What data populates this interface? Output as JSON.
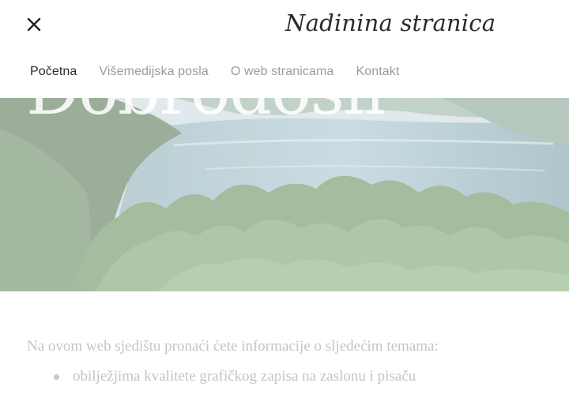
{
  "header": {
    "site_title": "Nadinina stranica",
    "close_icon": "close-icon"
  },
  "nav": {
    "items": [
      {
        "label": "Početna",
        "active": true
      },
      {
        "label": "Višemedijska posla",
        "active": false
      },
      {
        "label": "O web stranicama",
        "active": false
      },
      {
        "label": "Kontakt",
        "active": false
      }
    ]
  },
  "hero": {
    "heading": "Dobrodošli",
    "image": "lake-and-forest-photo"
  },
  "content": {
    "intro": "Na ovom web sjedištu pronaći ćete informacije o sljedećim temama:",
    "topics": [
      "obilježjima kvalitete grafičkog zapisa na zaslonu i pisaču"
    ]
  },
  "colors": {
    "active_nav": "#2a2a2a",
    "inactive_nav": "#9b9b9b",
    "faded_text": "#c4c4c4",
    "background": "#ffffff"
  }
}
